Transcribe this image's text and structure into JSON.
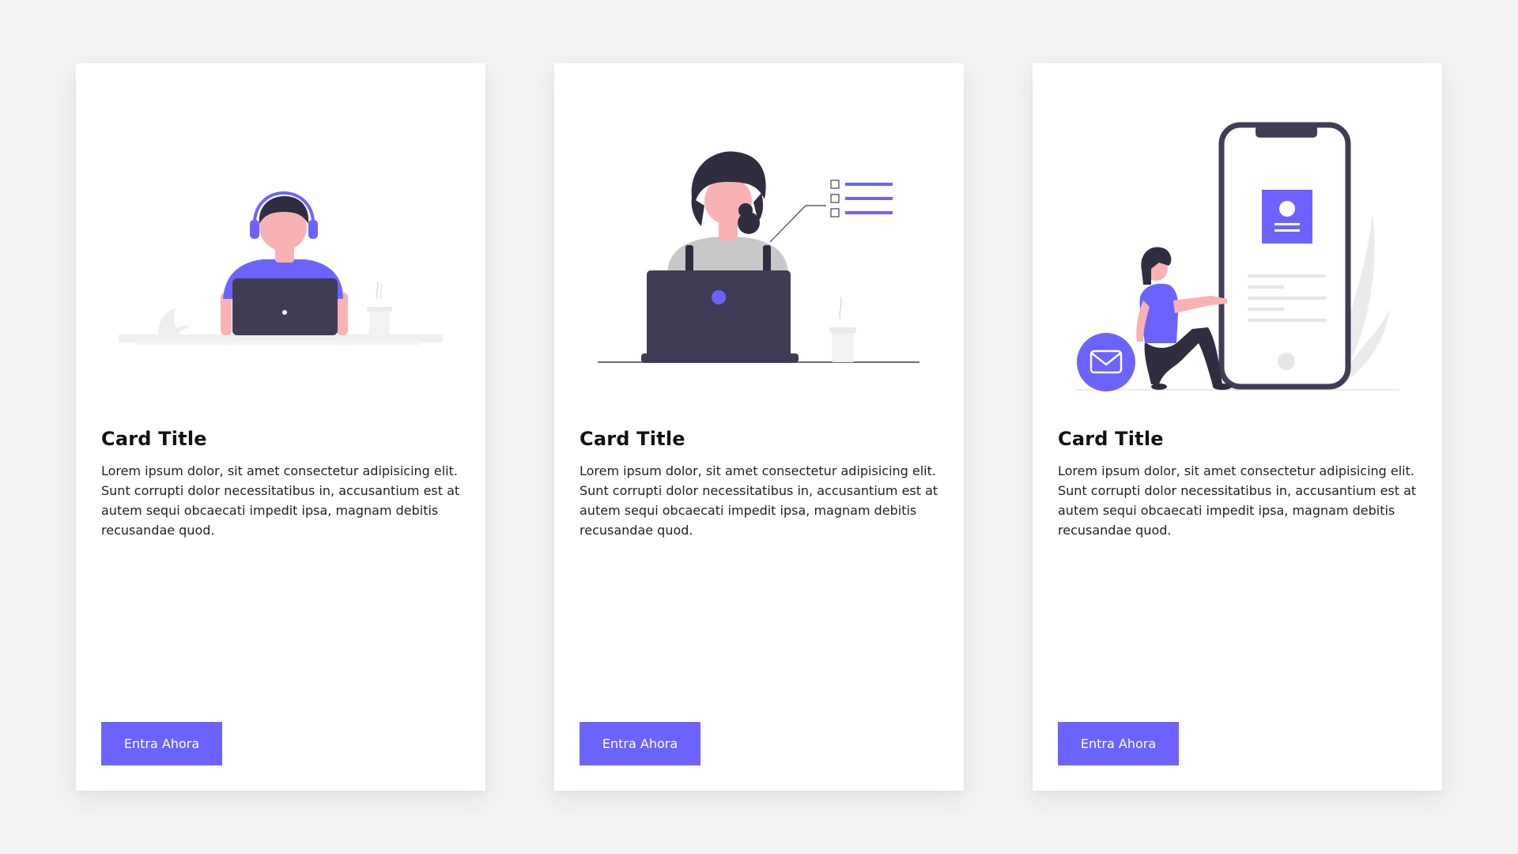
{
  "accent_color": "#6c63ff",
  "cards": [
    {
      "illustration": "person-with-headphones-at-laptop",
      "title": "Card Title",
      "text": "Lorem ipsum dolor, sit amet consectetur adipisicing elit. Sunt corrupti dolor necessitatibus in, accusantium est at autem sequi obcaecati impedit ipsa, magnam debitis recusandae quod.",
      "button_label": "Entra Ahora"
    },
    {
      "illustration": "woman-at-laptop-with-checklist",
      "title": "Card Title",
      "text": "Lorem ipsum dolor, sit amet consectetur adipisicing elit. Sunt corrupti dolor necessitatibus in, accusantium est at autem sequi obcaecati impedit ipsa, magnam debitis recusandae quod.",
      "button_label": "Entra Ahora"
    },
    {
      "illustration": "person-with-phone-and-mail",
      "title": "Card Title",
      "text": "Lorem ipsum dolor, sit amet consectetur adipisicing elit. Sunt corrupti dolor necessitatibus in, accusantium est at autem sequi obcaecati impedit ipsa, magnam debitis recusandae quod.",
      "button_label": "Entra Ahora"
    }
  ]
}
